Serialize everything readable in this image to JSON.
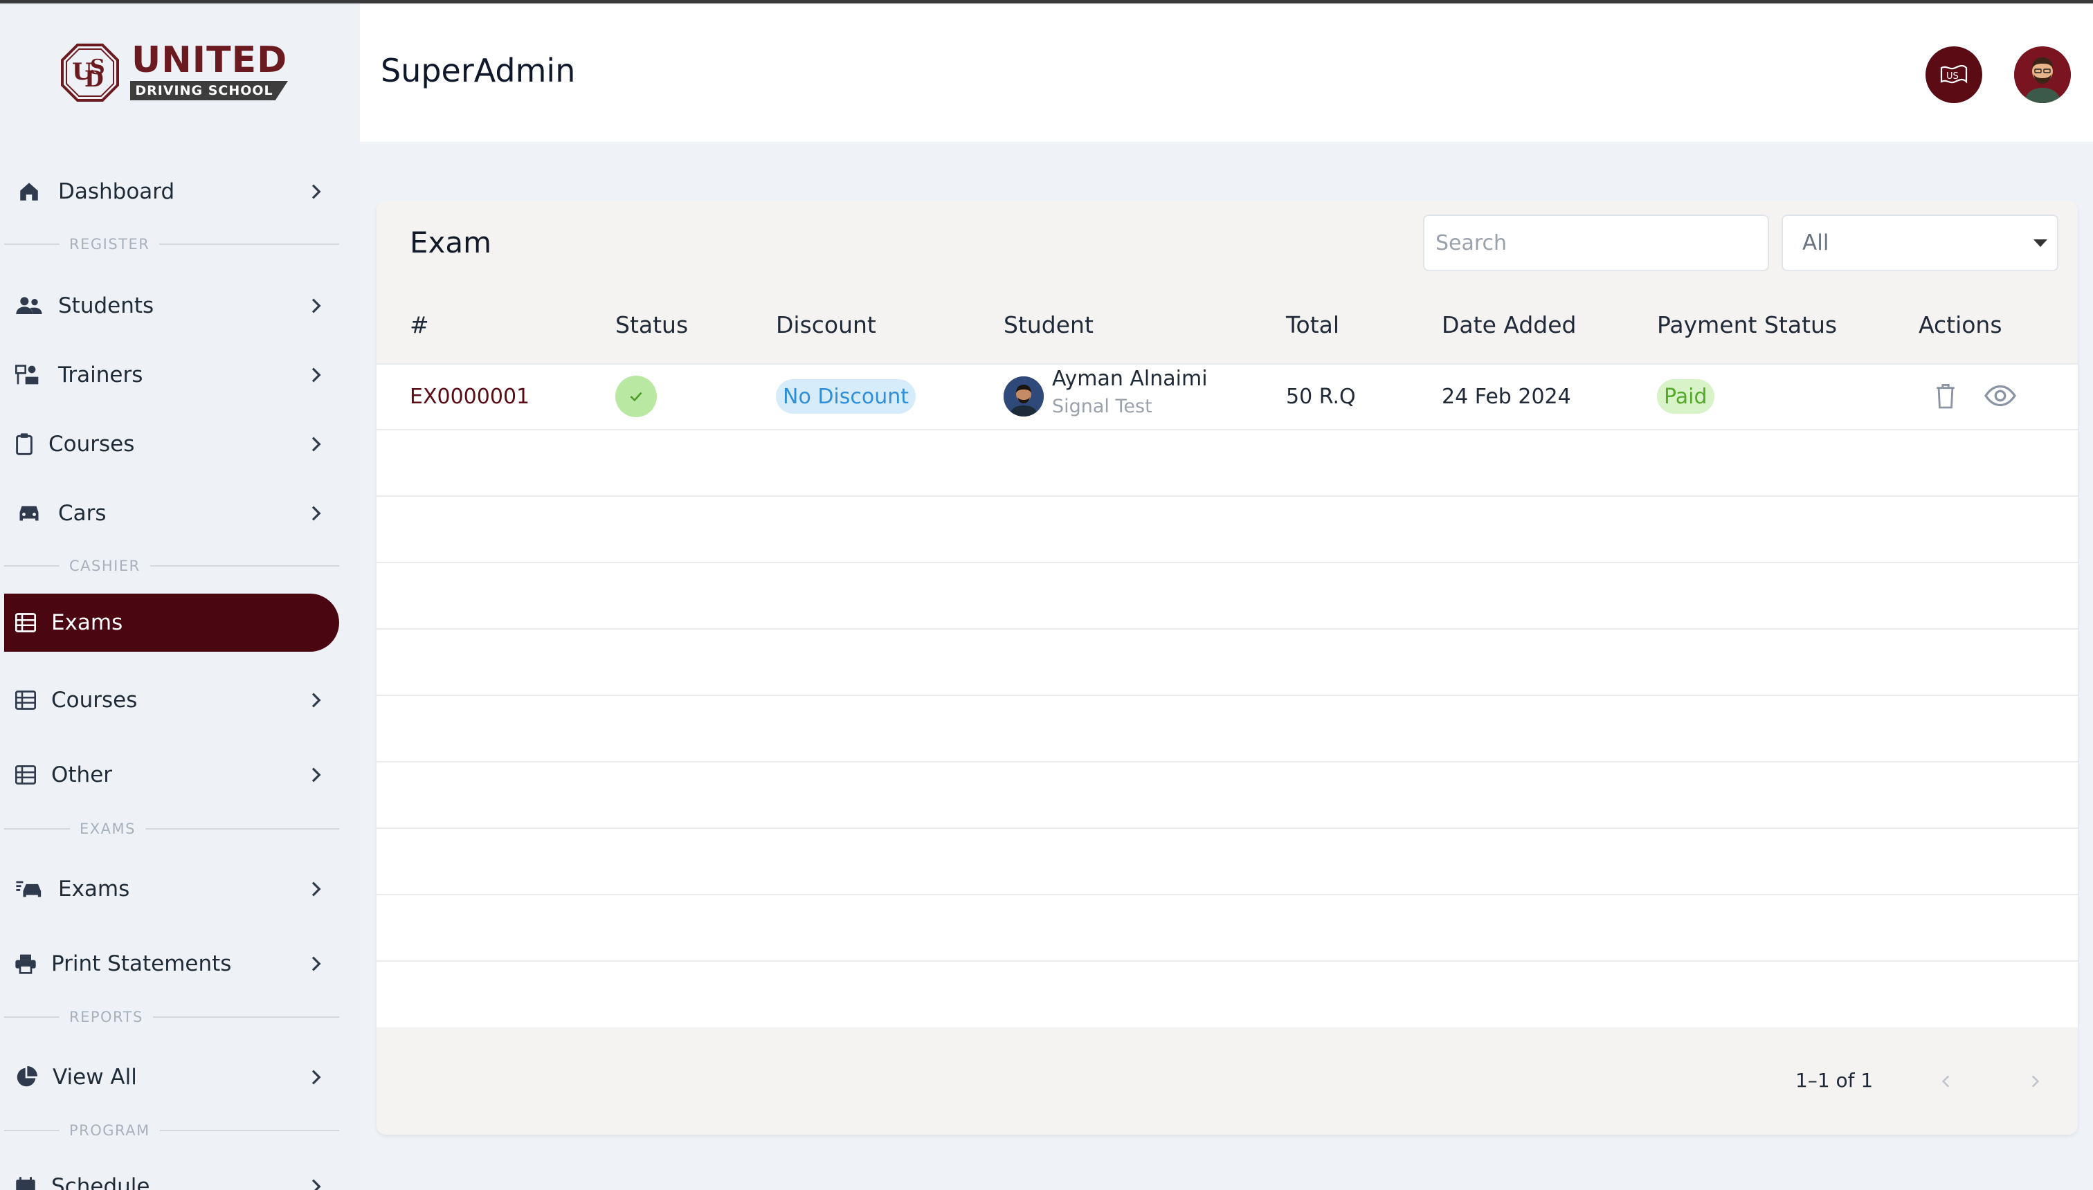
{
  "brand": {
    "name": "UNITED",
    "tagline": "DRIVING SCHOOL"
  },
  "header": {
    "title": "SuperAdmin",
    "language_button": "US"
  },
  "sidebar": {
    "dashboard": "Dashboard",
    "sections": {
      "register": "REGISTER",
      "cashier": "CASHIER",
      "exams": "EXAMS",
      "reports": "REPORTS",
      "program": "PROGRAM"
    },
    "register_items": [
      "Students",
      "Trainers",
      "Courses",
      "Cars"
    ],
    "cashier_items": [
      "Exams",
      "Courses",
      "Other"
    ],
    "exams_items": [
      "Exams",
      "Print Statements"
    ],
    "reports_items": [
      "View All"
    ],
    "program_items": [
      "Schedule"
    ],
    "active_item": "Exams"
  },
  "main": {
    "card_title": "Exam",
    "search_placeholder": "Search",
    "filter_selected": "All",
    "columns": [
      "#",
      "Status",
      "Discount",
      "Student",
      "Total",
      "Date Added",
      "Payment Status",
      "Actions"
    ],
    "rows": [
      {
        "id": "EX0000001",
        "status": "completed",
        "discount": "No Discount",
        "student_name": "Ayman Alnaimi",
        "student_sub": "Signal Test",
        "total": "50 R.Q",
        "date_added": "24 Feb 2024",
        "payment_status": "Paid"
      }
    ],
    "pagination": "1–1 of 1"
  },
  "colors": {
    "accent": "#4a0712",
    "paid": "#54a82a",
    "discount": "#2f8fd6"
  }
}
